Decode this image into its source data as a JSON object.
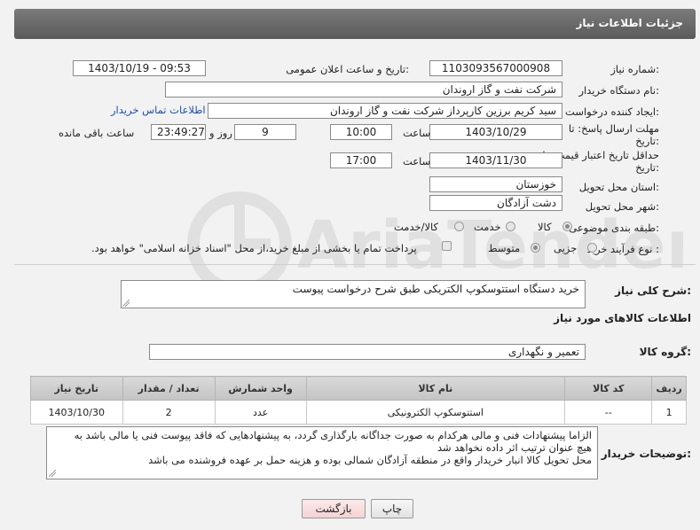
{
  "header": {
    "title": "جزئیات اطلاعات نیاز"
  },
  "form": {
    "need_number_label": "شماره نیاز:",
    "need_number": "1103093567000908",
    "announce_label": "تاریخ و ساعت اعلان عمومی:",
    "announce_value": "1403/10/19 - 09:53",
    "buyer_org_label": "نام دستگاه خریدار:",
    "buyer_org": "شرکت نفت و گاز اروندان",
    "creator_label": "ایجاد کننده درخواست:",
    "creator": "سید کریم برزین کارپرداز شرکت نفت و گاز اروندان",
    "contact_link": "اطلاعات تماس خریدار",
    "deadline_label_1": "مهلت ارسال پاسخ: تا",
    "deadline_label_2": "تاریخ:",
    "deadline_date": "1403/10/29",
    "time_label": "ساعت",
    "deadline_time": "10:00",
    "days_value": "9",
    "days_label": "روز و",
    "remaining_time": "23:49:27",
    "remaining_label": "ساعت باقی مانده",
    "validity_label_1": "حداقل تاریخ اعتبار قیمت: تا",
    "validity_label_2": "تاریخ:",
    "validity_date": "1403/11/30",
    "validity_time": "17:00",
    "province_label": "استان محل تحویل:",
    "province": "خوزستان",
    "city_label": "شهر محل تحویل:",
    "city": "دشت آزادگان",
    "category_label": "طبقه بندی موضوعی:",
    "category_options": [
      "کالا",
      "خدمت",
      "کالا/خدمت"
    ],
    "process_label": "نوع فرآیند خرید :",
    "process_options": [
      "جزیی",
      "متوسط"
    ],
    "payment_note": "پرداخت تمام یا بخشی از مبلغ خرید،از محل \"اسناد خزانه اسلامی\" خواهد بود."
  },
  "description": {
    "label": "شرح کلی نیاز:",
    "text": "خرید دستگاه استتوسکوپ الکتریکی طبق شرح درخواست پیوست"
  },
  "goods": {
    "section_title": "اطلاعات کالاهای مورد نیاز",
    "group_label": "گروه کالا:",
    "group_value": "تعمیر و نگهداری",
    "columns": [
      "ردیف",
      "کد کالا",
      "نام کالا",
      "واحد شمارش",
      "تعداد / مقدار",
      "تاریخ نیاز"
    ],
    "rows": [
      {
        "index": "1",
        "code": "--",
        "name": "استتوسکوپ الکترونیکی",
        "unit": "عدد",
        "qty": "2",
        "date": "1403/10/30"
      }
    ]
  },
  "buyer_notes": {
    "label": "توضیحات خریدار:",
    "line1": "الزاما پیشنهادات فنی و مالی هرکدام به صورت جداگانه بارگذاری گردد، به پیشنهادهایی که فاقد پیوست فنی یا مالی باشد به",
    "line2": "هیچ عنوان ترتیب اثر داده نخواهد شد",
    "line3": "محل تحویل کالا انبار خریدار واقع در منطقه آزادگان شمالی بوده و هزینه حمل بر عهده فروشنده می باشد"
  },
  "buttons": {
    "print": "چاپ",
    "back": "بازگشت"
  },
  "watermark": {
    "text": "AriaTender.neT"
  }
}
